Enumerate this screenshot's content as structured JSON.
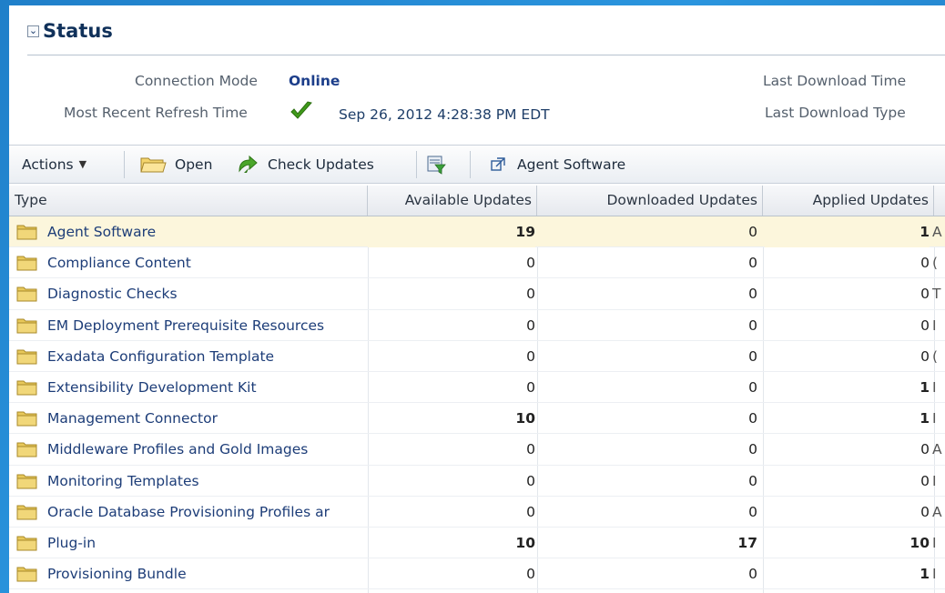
{
  "status": {
    "title": "Status",
    "collapse_glyph": "⌄",
    "connection_mode_label": "Connection Mode",
    "connection_mode_value": "Online",
    "refresh_label": "Most Recent Refresh Time",
    "refresh_value": "Sep 26, 2012 4:28:38 PM EDT",
    "last_download_time_label": "Last Download Time",
    "last_download_type_label": "Last Download Type"
  },
  "toolbar": {
    "actions_label": "Actions",
    "open_label": "Open",
    "check_updates_label": "Check Updates",
    "agent_software_label": "Agent Software"
  },
  "table": {
    "headers": {
      "type": "Type",
      "available": "Available Updates",
      "downloaded": "Downloaded Updates",
      "applied": "Applied Updates"
    },
    "rows": [
      {
        "type": "Agent Software",
        "available": "19",
        "downloaded": "0",
        "applied": "1",
        "trail": "A",
        "selected": true,
        "bold_available": true,
        "bold_applied": true
      },
      {
        "type": "Compliance Content",
        "available": "0",
        "downloaded": "0",
        "applied": "0",
        "trail": "("
      },
      {
        "type": "Diagnostic Checks",
        "available": "0",
        "downloaded": "0",
        "applied": "0",
        "trail": "T"
      },
      {
        "type": "EM Deployment Prerequisite Resources",
        "available": "0",
        "downloaded": "0",
        "applied": "0",
        "trail": "I"
      },
      {
        "type": "Exadata Configuration Template",
        "available": "0",
        "downloaded": "0",
        "applied": "0",
        "trail": "("
      },
      {
        "type": "Extensibility Development Kit",
        "available": "0",
        "downloaded": "0",
        "applied": "1",
        "trail": "I",
        "bold_applied": true
      },
      {
        "type": "Management Connector",
        "available": "10",
        "downloaded": "0",
        "applied": "1",
        "trail": "I",
        "bold_available": true,
        "bold_applied": true
      },
      {
        "type": "Middleware Profiles and Gold Images",
        "available": "0",
        "downloaded": "0",
        "applied": "0",
        "trail": "A"
      },
      {
        "type": "Monitoring Templates",
        "available": "0",
        "downloaded": "0",
        "applied": "0",
        "trail": "I"
      },
      {
        "type": "Oracle Database Provisioning Profiles ar",
        "available": "0",
        "downloaded": "0",
        "applied": "0",
        "trail": "A"
      },
      {
        "type": "Plug-in",
        "available": "10",
        "downloaded": "17",
        "applied": "10",
        "trail": "I",
        "bold_available": true,
        "bold_downloaded": true,
        "bold_applied": true
      },
      {
        "type": "Provisioning Bundle",
        "available": "0",
        "downloaded": "0",
        "applied": "1",
        "trail": "I",
        "bold_applied": true
      }
    ]
  },
  "colors": {
    "background": "#1f7fc9",
    "link_text": "#1d3d78",
    "selected_row": "#fcf6dc",
    "check_green": "#3f9a1a",
    "folder_yellow": "#e8c85a"
  },
  "icons": {
    "collapse": "chevron-down-icon",
    "refresh_ok": "checkmark-icon",
    "open": "folder-open-icon",
    "check_updates": "check-updates-icon",
    "filter": "filter-icon",
    "agent_software": "link-icon",
    "row_type": "folder-icon"
  }
}
